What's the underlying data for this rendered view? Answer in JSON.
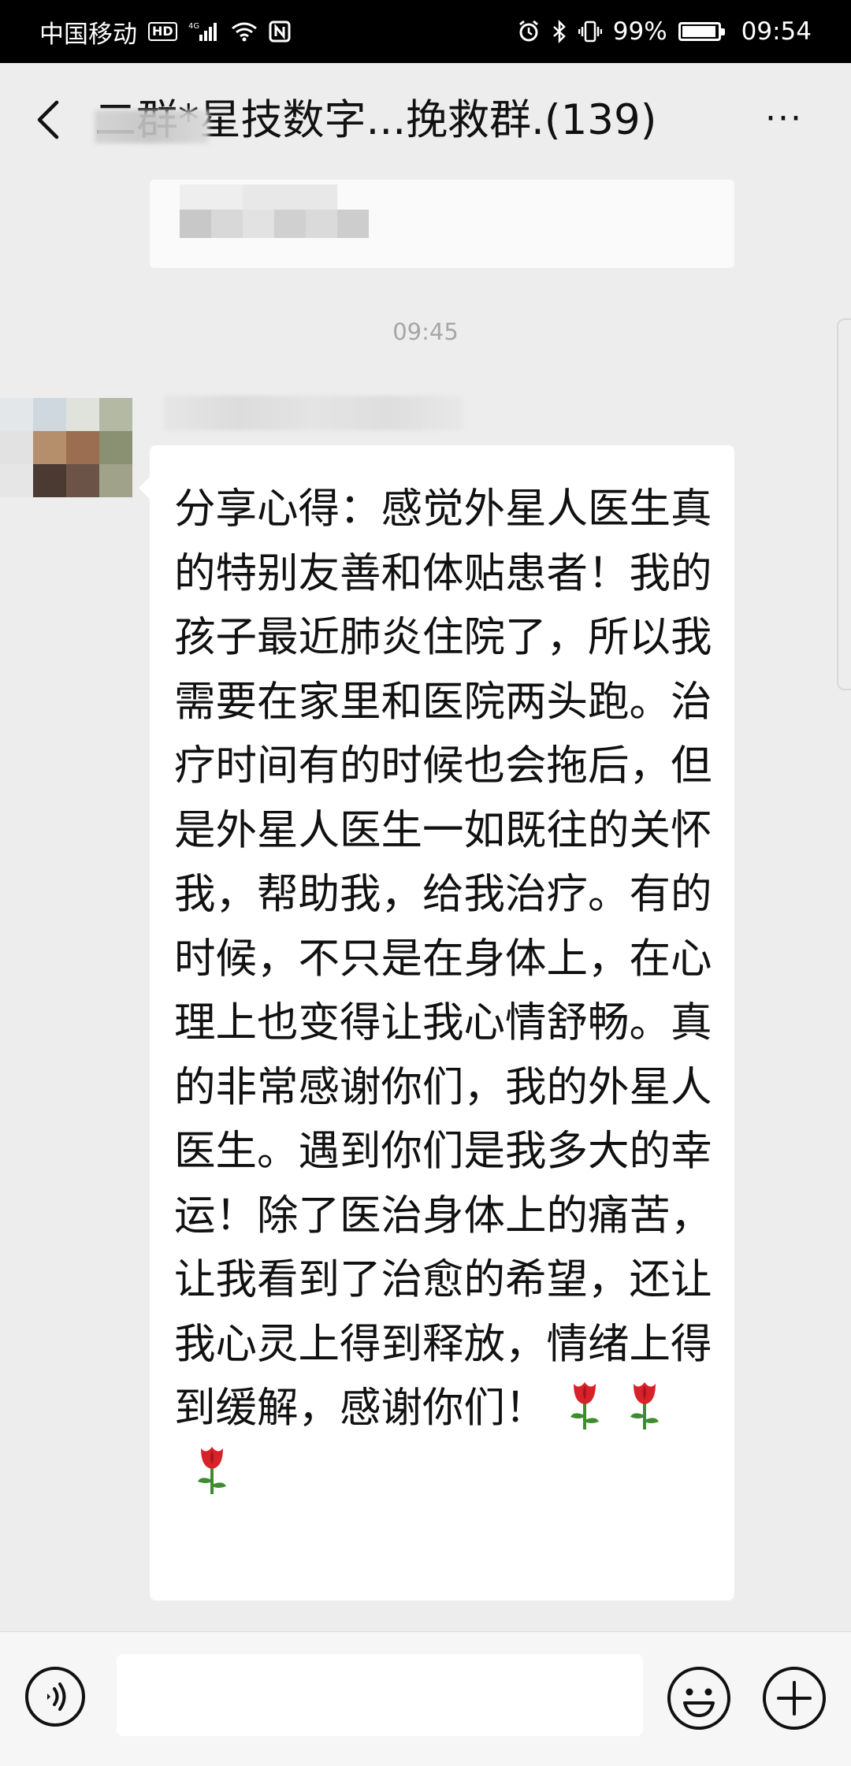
{
  "status_bar": {
    "carrier": "中国移动",
    "hd_badge": "HD",
    "network": "4G",
    "battery": "99%",
    "time": "09:54",
    "icons": [
      "hd-icon",
      "signal-icon",
      "wifi-icon",
      "nfc-icon",
      "alarm-icon",
      "bluetooth-icon",
      "vibrate-icon",
      "battery-icon"
    ]
  },
  "header": {
    "title": "二群*星技数字...挽救群.(139)",
    "back_icon": "chevron-left-icon",
    "more_icon": "ellipsis-icon",
    "more_label": "···"
  },
  "timestamp": "09:45",
  "message": {
    "text": "分享心得：感觉外星人医生真的特别友善和体贴患者！我的孩子最近肺炎住院了，所以我需要在家里和医院两头跑。治疗时间有的时候也会拖后，但是外星人医生一如既往的关怀我，帮助我，给我治疗。有的时候，不只是在身体上，在心理上也变得让我心情舒畅。真的非常感谢你们，我的外星人医生。遇到你们是我多大的幸运！除了医治身体上的痛苦，让我看到了治愈的希望，还让我心灵上得到释放，情绪上得到缓解，感谢你们！",
    "emoji": [
      "rose",
      "rose",
      "rose"
    ]
  },
  "input_bar": {
    "value": "",
    "voice_icon": "voice-icon",
    "emoji_icon": "emoji-icon",
    "plus_icon": "plus-icon"
  },
  "colors": {
    "background": "#ededed",
    "bubble": "#ffffff",
    "status_bar": "#000000",
    "timestamp": "#a6a6a6",
    "rose_red": "#d8222a",
    "rose_green": "#3f8b2f"
  }
}
